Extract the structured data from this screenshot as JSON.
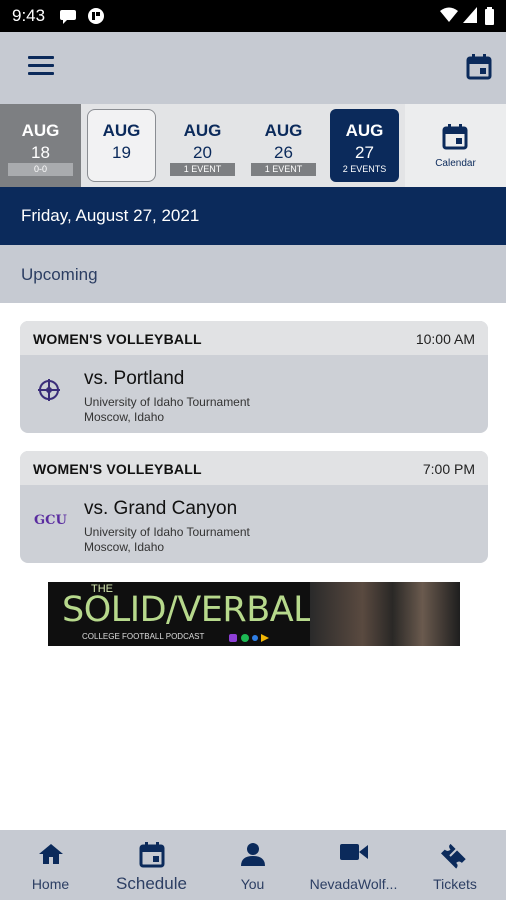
{
  "status_bar": {
    "time": "9:43"
  },
  "date_strip": [
    {
      "month": "AUG",
      "day": "18",
      "badge": "0-0",
      "state": "grey"
    },
    {
      "month": "AUG",
      "day": "19",
      "badge": "",
      "state": "outlined"
    },
    {
      "month": "AUG",
      "day": "20",
      "badge": "1 EVENT",
      "state": "plain"
    },
    {
      "month": "AUG",
      "day": "26",
      "badge": "1 EVENT",
      "state": "plain"
    },
    {
      "month": "AUG",
      "day": "27",
      "badge": "2 EVENTS",
      "state": "selected"
    }
  ],
  "calendar_label": "Calendar",
  "selected_date": "Friday, August 27, 2021",
  "section_title": "Upcoming",
  "events": [
    {
      "sport": "WOMEN'S VOLLEYBALL",
      "time": "10:00 AM",
      "opponent": "vs. Portland",
      "event_name": "University of Idaho Tournament",
      "location": "Moscow, Idaho",
      "logo_icon": "portland-pilots-logo-icon"
    },
    {
      "sport": "WOMEN'S VOLLEYBALL",
      "time": "7:00 PM",
      "opponent": "vs. Grand Canyon",
      "event_name": "University of Idaho Tournament",
      "location": "Moscow, Idaho",
      "logo_icon": "gcu-logo-icon",
      "logo_text": "GCU"
    }
  ],
  "ad": {
    "line1": "THE",
    "line2": "SOLID/VERBAL",
    "line3": "COLLEGE FOOTBALL PODCAST"
  },
  "bottom_nav": [
    {
      "label": "Home",
      "icon": "home-icon"
    },
    {
      "label": "Schedule",
      "icon": "calendar-icon",
      "active": true
    },
    {
      "label": "You",
      "icon": "person-icon"
    },
    {
      "label": "NevadaWolf...",
      "icon": "video-camera-icon"
    },
    {
      "label": "Tickets",
      "icon": "ticket-icon"
    }
  ],
  "colors": {
    "navy": "#0b2a5b",
    "light_bar": "#c6cad2",
    "strip_bg": "#e3e4e6",
    "grey_cell": "#7d7f82"
  }
}
